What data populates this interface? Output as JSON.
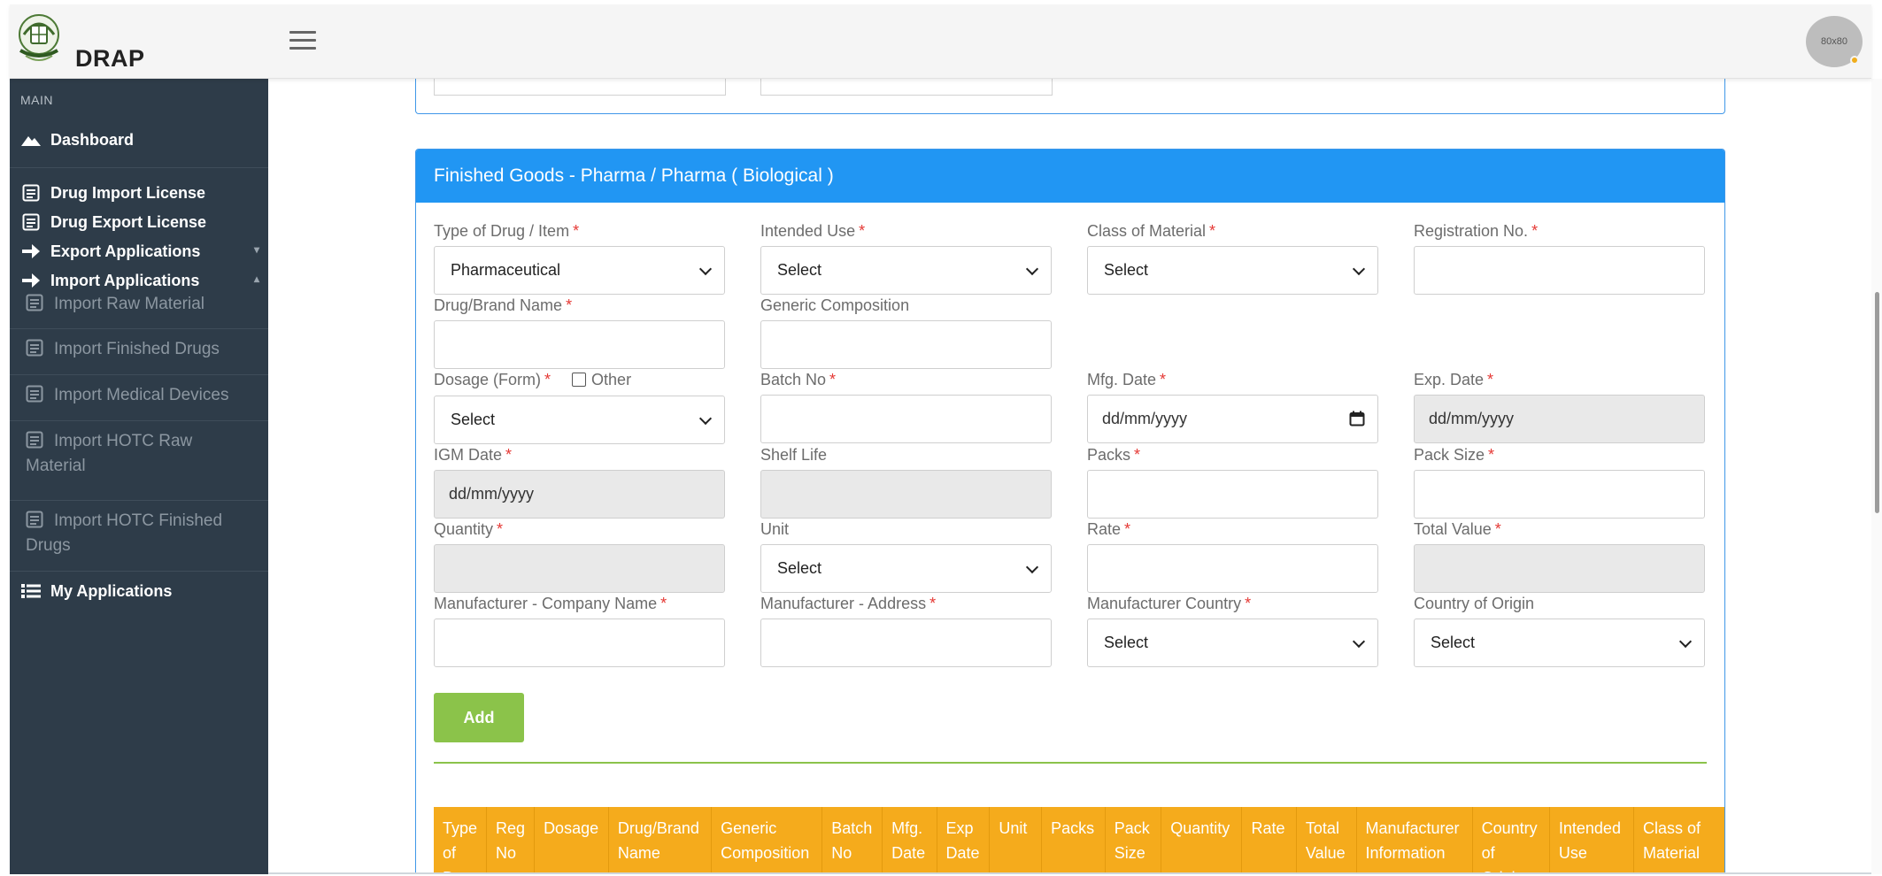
{
  "header": {
    "brand": "DRAP",
    "avatar_text": "80x80"
  },
  "sidebar": {
    "section_label": "MAIN",
    "dashboard": "Dashboard",
    "drug_import_license": "Drug Import License",
    "drug_export_license": "Drug Export License",
    "export_applications": "Export Applications",
    "import_applications": "Import Applications",
    "sub_items": [
      {
        "label": "Import Raw Material"
      },
      {
        "label": "Import Finished Drugs"
      },
      {
        "label": "Import Medical Devices"
      },
      {
        "label": "Import HOTC Raw Material"
      },
      {
        "label": "Import HOTC Finished Drugs"
      }
    ],
    "my_applications": "My Applications"
  },
  "form": {
    "title": "Finished Goods - Pharma / Pharma ( Biological )",
    "required_mark": "*",
    "type_of_drug_label": "Type of Drug / Item",
    "type_of_drug_value": "Pharmaceutical",
    "intended_use_label": "Intended Use",
    "intended_use_value": "Select",
    "class_of_material_label": "Class of Material",
    "class_of_material_value": "Select",
    "registration_no_label": "Registration No.",
    "brand_name_label": "Drug/Brand Name",
    "generic_composition_label": "Generic Composition",
    "dosage_form_label": "Dosage (Form)",
    "dosage_other_label": "Other",
    "dosage_form_value": "Select",
    "batch_no_label": "Batch No",
    "mfg_date_label": "Mfg. Date",
    "mfg_date_value": "dd/mm/yyyy",
    "exp_date_label": "Exp. Date",
    "exp_date_value": "dd/mm/yyyy",
    "igm_date_label": "IGM Date",
    "igm_date_value": "dd/mm/yyyy",
    "shelf_life_label": "Shelf Life",
    "packs_label": "Packs",
    "pack_size_label": "Pack Size",
    "quantity_label": "Quantity",
    "unit_label": "Unit",
    "unit_value": "Select",
    "rate_label": "Rate",
    "total_value_label": "Total Value",
    "manufacturer_company_label": "Manufacturer - Company Name",
    "manufacturer_address_label": "Manufacturer - Address",
    "manufacturer_country_label": "Manufacturer Country",
    "manufacturer_country_value": "Select",
    "country_of_origin_label": "Country of Origin",
    "country_of_origin_value": "Select",
    "add_button": "Add"
  },
  "table": {
    "headers": [
      "Type of Drug",
      "Reg No",
      "Dosage",
      "Drug/Brand Name",
      "Generic Composition",
      "Batch No",
      "Mfg. Date",
      "Exp Date",
      "Unit",
      "Packs",
      "Pack Size",
      "Quantity",
      "Rate",
      "Total Value",
      "Manufacturer Information",
      "Country of Origin",
      "Intended Use",
      "Class of Material"
    ]
  },
  "colors": {
    "sidebar_bg": "#2e3c49",
    "card_header": "#2196f3",
    "add_button": "#8bc34a",
    "table_header": "#f5ab1c",
    "required": "#e53935"
  }
}
